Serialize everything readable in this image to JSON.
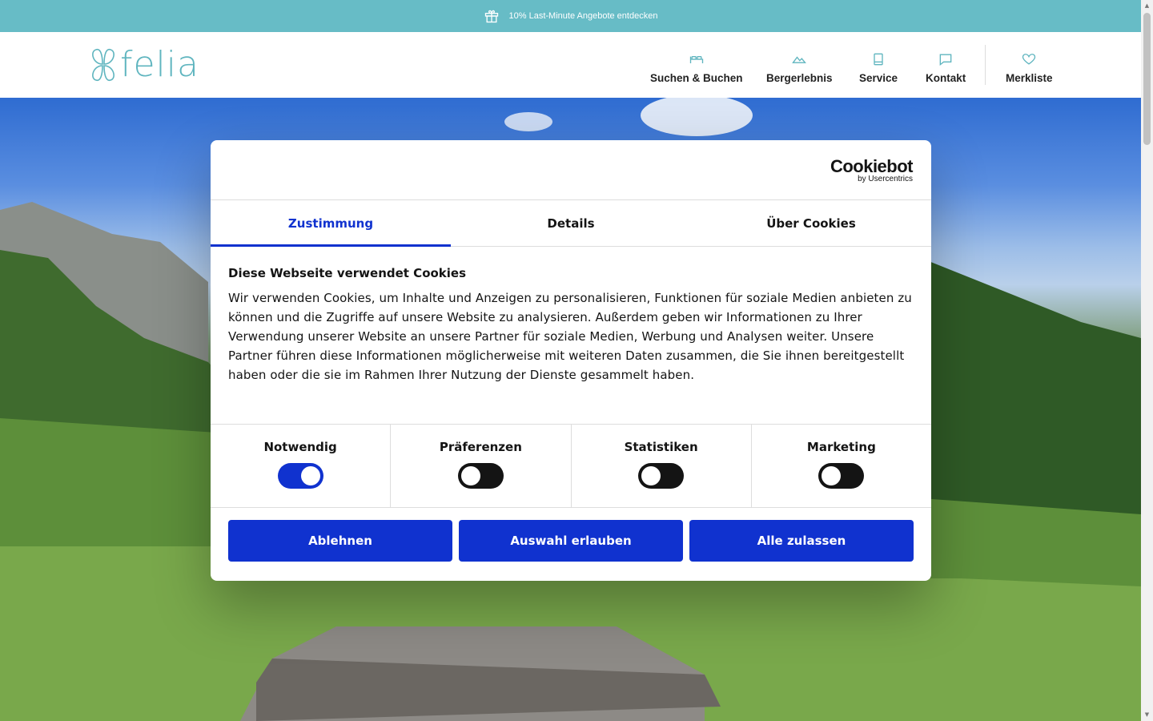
{
  "promo": {
    "text": "10% Last-Minute Angebote entdecken",
    "icon": "gift-icon"
  },
  "brand": {
    "name": "felia",
    "color": "#5fb5bf"
  },
  "nav": [
    {
      "label": "Suchen & Buchen",
      "icon": "bed-icon"
    },
    {
      "label": "Bergerlebnis",
      "icon": "mountain-icon"
    },
    {
      "label": "Service",
      "icon": "book-icon"
    },
    {
      "label": "Kontakt",
      "icon": "chat-icon"
    },
    {
      "label": "Merkliste",
      "icon": "heart-icon"
    }
  ],
  "consent": {
    "provider": {
      "name": "Cookiebot",
      "sub": "by Usercentrics"
    },
    "tabs": [
      {
        "label": "Zustimmung",
        "active": true
      },
      {
        "label": "Details",
        "active": false
      },
      {
        "label": "Über Cookies",
        "active": false
      }
    ],
    "title": "Diese Webseite verwendet Cookies",
    "body": "Wir verwenden Cookies, um Inhalte und Anzeigen zu personalisieren, Funktionen für soziale Medien anbieten zu können und die Zugriffe auf unsere Website zu analysieren. Außerdem geben wir Informationen zu Ihrer Verwendung unserer Website an unsere Partner für soziale Medien, Werbung und Analysen weiter. Unsere Partner führen diese Informationen möglicherweise mit weiteren Daten zusammen, die Sie ihnen bereitgestellt haben oder die sie im Rahmen Ihrer Nutzung der Dienste gesammelt haben.",
    "categories": [
      {
        "label": "Notwendig",
        "enabled": true
      },
      {
        "label": "Präferenzen",
        "enabled": false
      },
      {
        "label": "Statistiken",
        "enabled": false
      },
      {
        "label": "Marketing",
        "enabled": false
      }
    ],
    "buttons": {
      "decline": "Ablehnen",
      "allow_selection": "Auswahl erlauben",
      "allow_all": "Alle zulassen"
    },
    "accent": "#1032cf"
  },
  "colors": {
    "promo_bar": "#67bcc6",
    "accent": "#1032cf"
  }
}
